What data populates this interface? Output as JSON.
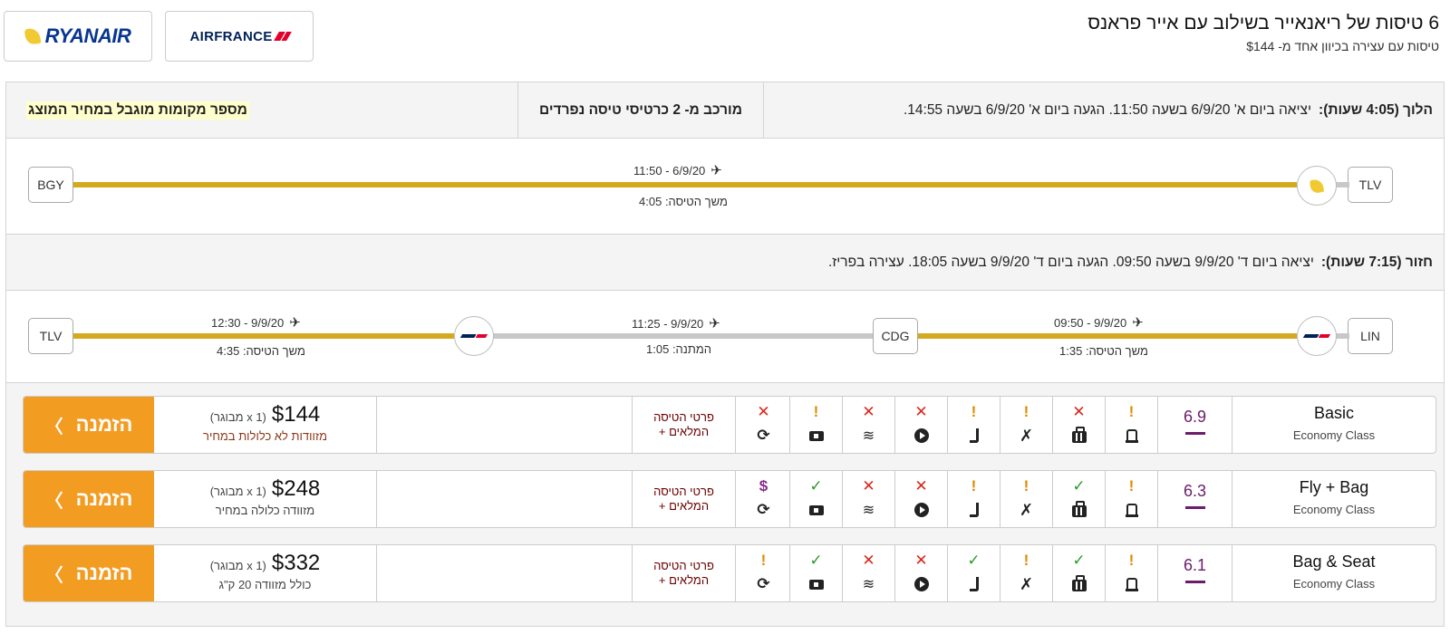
{
  "header": {
    "airline_logos": [
      "RYANAIR",
      "AIRFRANCE"
    ],
    "title": "6 טיסות של ריאנאייר בשילוב עם אייר פראנס",
    "subtitle": "טיסות עם עצירה בכיוון אחד מ- $144"
  },
  "outbound": {
    "label": "הלוך (4:05 שעות):",
    "info": "יציאה ביום א' 6/9/20 בשעה 11:50. הגעה ביום א' 6/9/20 בשעה 14:55.",
    "tickets_note": "מורכב מ- 2 כרטיסי טיסה נפרדים",
    "seats_note": "מספר מקומות מוגבל במחיר המוצג",
    "origin": "TLV",
    "destination": "BGY",
    "leg_time": "6/9/20 - 11:50",
    "duration_label": "משך הטיסה:",
    "duration": "4:05"
  },
  "return": {
    "label": "חזור (7:15 שעות):",
    "info": "יציאה ביום ד' 9/9/20 בשעה 09:50. הגעה ביום ד' 9/9/20 בשעה 18:05. עצירה בפריז.",
    "airports": [
      "LIN",
      "CDG",
      "TLV"
    ],
    "leg1_time": "9/9/20 - 09:50",
    "leg1_duration_label": "משך הטיסה:",
    "leg1_duration": "1:35",
    "stop_time": "9/9/20 - 11:25",
    "stop_label": "המתנה:",
    "stop_duration": "1:05",
    "leg2_time": "9/9/20 - 12:30",
    "leg2_duration_label": "משך הטיסה:",
    "leg2_duration": "4:35"
  },
  "fares": [
    {
      "class_name": "Basic",
      "class_sub": "Economy Class",
      "score": "6.9",
      "features": [
        "warn",
        "cross",
        "warn",
        "warn",
        "cross",
        "cross",
        "warn",
        "cross"
      ],
      "details": "פרטי הטיסה המלאים +",
      "price": "$144",
      "price_unit": "(1 x מבוגר)",
      "price_note": "מזוודות לא כלולות במחיר",
      "book_label": "הזמנה",
      "chevron": "〉"
    },
    {
      "class_name": "Fly + Bag",
      "class_sub": "Economy Class",
      "score": "6.3",
      "features": [
        "warn",
        "check",
        "warn",
        "warn",
        "cross",
        "cross",
        "check",
        "dollar"
      ],
      "details": "פרטי הטיסה המלאים +",
      "price": "$248",
      "price_unit": "(1 x מבוגר)",
      "price_note": "מזוודה כלולה במחיר",
      "book_label": "הזמנה",
      "chevron": "〉"
    },
    {
      "class_name": "Bag & Seat",
      "class_sub": "Economy Class",
      "score": "6.1",
      "features": [
        "warn",
        "check",
        "warn",
        "check",
        "cross",
        "cross",
        "check",
        "warn"
      ],
      "details": "פרטי הטיסה המלאים +",
      "price": "$332",
      "price_unit": "(1 x מבוגר)",
      "price_note": "כולל מזוודה 20 ק\"ג",
      "book_label": "הזמנה",
      "chevron": "〉"
    }
  ],
  "status_symbols": {
    "cross": "✕",
    "warn": "!",
    "check": "✓",
    "dollar": "$"
  },
  "colors": {
    "accent": "#f39c22",
    "route_gold": "#d4a91e",
    "score_purple": "#6a1d6a"
  }
}
